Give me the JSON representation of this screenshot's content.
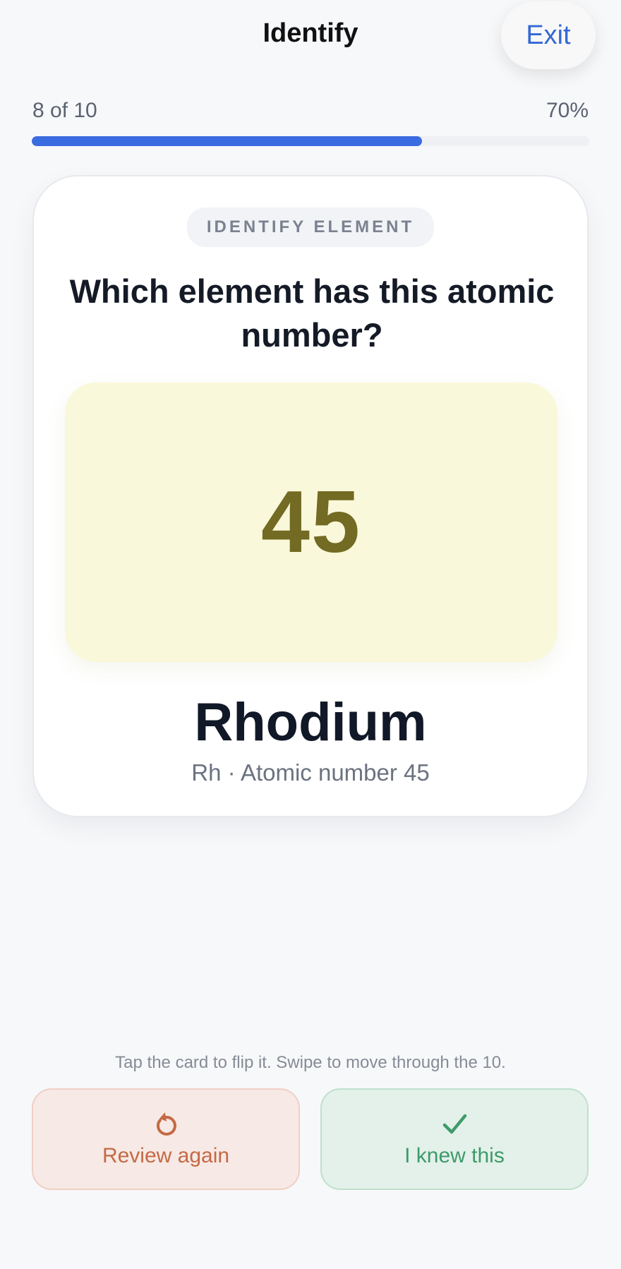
{
  "header": {
    "title": "Identify",
    "exit_label": "Exit"
  },
  "progress": {
    "label": "8 of 10",
    "percent_label": "70%",
    "fill_percent": 70
  },
  "card": {
    "tag": "IDENTIFY ELEMENT",
    "question": "Which element has this atomic number?",
    "number": "45",
    "answer_name": "Rhodium",
    "answer_detail": "Rh · Atomic number 45"
  },
  "footer": {
    "hint": "Tap the card to flip it. Swipe to move through the 10.",
    "review_label": "Review again",
    "review_icon": "retry-arrow-icon",
    "knew_label": "I knew this",
    "knew_icon": "checkmark-icon"
  },
  "colors": {
    "accent": "#3a6be0",
    "exit": "#3368d3",
    "number_box": "#faf8da",
    "number_text": "#736a23",
    "review": "#c46a45",
    "knew": "#3e9a6a"
  }
}
